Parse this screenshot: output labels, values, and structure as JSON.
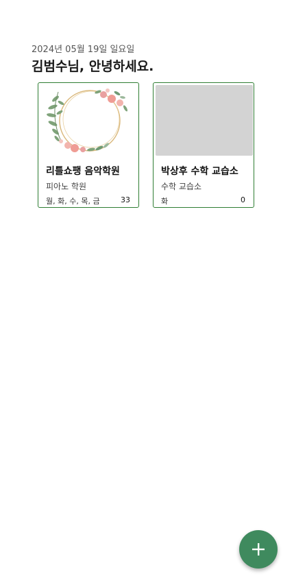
{
  "header": {
    "date": "2024년 05월 19일 일요일",
    "greeting": "김범수님, 안녕하세요."
  },
  "cards": [
    {
      "title": "리틀쇼팽 음악학원",
      "subtitle": "피아노 학원",
      "days": "월, 화, 수, 목, 금",
      "count": "33",
      "image": "floral-wreath"
    },
    {
      "title": "박상후 수학 교습소",
      "subtitle": "수학 교습소",
      "days": "화",
      "count": "0",
      "image": "placeholder"
    }
  ],
  "fab": {
    "icon": "plus-icon",
    "color": "#3f8a5e"
  },
  "colors": {
    "card_border": "#2e7d32",
    "placeholder": "#d3d3d3"
  }
}
